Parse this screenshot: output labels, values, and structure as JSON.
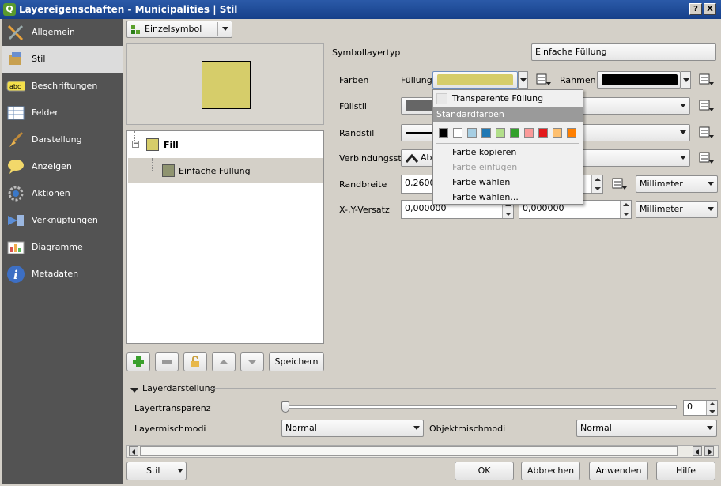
{
  "window": {
    "title": "Layereigenschaften - Municipalities | Stil",
    "help_btn": "?",
    "close_btn": "X"
  },
  "sidebar": {
    "items": [
      {
        "label": "Allgemein",
        "icon": "tools-icon"
      },
      {
        "label": "Stil",
        "icon": "paintbrush-icon",
        "selected": true
      },
      {
        "label": "Beschriftungen",
        "icon": "abc-label-icon"
      },
      {
        "label": "Felder",
        "icon": "table-icon"
      },
      {
        "label": "Darstellung",
        "icon": "brush-icon"
      },
      {
        "label": "Anzeigen",
        "icon": "speech-bubble-icon"
      },
      {
        "label": "Aktionen",
        "icon": "gear-icon"
      },
      {
        "label": "Verknüpfungen",
        "icon": "join-icon"
      },
      {
        "label": "Diagramme",
        "icon": "diagram-icon"
      },
      {
        "label": "Metadaten",
        "icon": "info-icon"
      }
    ]
  },
  "renderer": {
    "value": "Einzelsymbol"
  },
  "preview": {
    "fill_color": "#d6cd6a"
  },
  "symbol_tree": {
    "root": {
      "label": "Fill",
      "color": "#d6cd6a"
    },
    "child": {
      "label": "Einfache Füllung",
      "color": "#8f9470"
    }
  },
  "layer_buttons": {
    "save": "Speichern"
  },
  "props": {
    "symbollayertyp_label": "Symbollayertyp",
    "symbollayertyp_value": "Einfache Füllung",
    "farben_label": "Farben",
    "fuellung_label": "Füllung",
    "fill_color": "#d6cd6a",
    "rahmen_label": "Rahmen",
    "border_color": "#000000",
    "fuellstil_label": "Füllstil",
    "randstil_label": "Randstil",
    "verbindungsstil_label": "Verbindungsstil",
    "verbindungsstil_value": "Abg",
    "randbreite_label": "Randbreite",
    "randbreite_value": "0,26000",
    "randbreite_unit": "Millimeter",
    "versatz_label": "X-,Y-Versatz",
    "versatz_x": "0,000000",
    "versatz_y": "0,000000",
    "versatz_unit": "Millimeter"
  },
  "popup": {
    "transparent": "Transparente Füllung",
    "standardfarben": "Standardfarben",
    "swatches": [
      "#000000",
      "#ffffff",
      "#a6cee3",
      "#1f78b4",
      "#b2df8a",
      "#33a02c",
      "#fb9a99",
      "#e31a1c",
      "#fdbf6f",
      "#ff7f00"
    ],
    "copy": "Farbe kopieren",
    "paste": "Farbe einfügen",
    "choose": "Farbe wählen",
    "choose_dots": "Farbe wählen..."
  },
  "layer_rendering": {
    "title": "Layerdarstellung",
    "transparency_label": "Layertransparenz",
    "transparency_value": "0",
    "blend_label": "Layermischmodi",
    "blend_value": "Normal",
    "object_blend_label": "Objektmischmodi",
    "object_blend_value": "Normal"
  },
  "footer": {
    "stil": "Stil",
    "ok": "OK",
    "cancel": "Abbrechen",
    "apply": "Anwenden",
    "help": "Hilfe"
  }
}
